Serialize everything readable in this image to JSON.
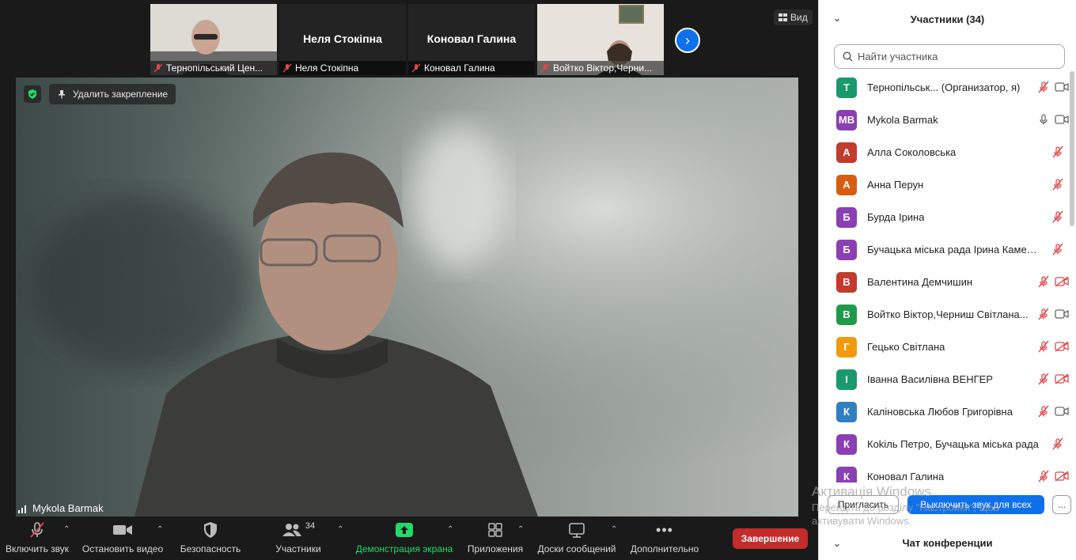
{
  "thumbnails": [
    {
      "name": "Тернопільський Цен...",
      "has_video": true,
      "muted": true
    },
    {
      "name": "Неля Стокіпна",
      "big_name": "Неля Стокіпна",
      "has_video": false,
      "muted": true
    },
    {
      "name": "Коновал Галина",
      "big_name": "Коновал Галина",
      "has_video": false,
      "muted": true
    },
    {
      "name": "Войтко Віктор,Черни...",
      "has_video": true,
      "muted": true
    }
  ],
  "view_button": "Вид",
  "unpin_label": "Удалить закрепление",
  "active_speaker": "Mykola Barmak",
  "toolbar": {
    "unmute": "Включить звук",
    "stop_video": "Остановить видео",
    "security": "Безопасность",
    "participants": "Участники",
    "participants_count": "34",
    "share": "Демонстрация экрана",
    "apps": "Приложения",
    "whiteboards": "Доски сообщений",
    "more": "Дополнительно",
    "end": "Завершение"
  },
  "panel": {
    "title": "Участники (34)",
    "search_placeholder": "Найти участника",
    "participants": [
      {
        "initials": "Т",
        "color": "#1a9a6b",
        "name": "Тернопільськ... (Организатор, я)",
        "mic": "muted",
        "video": "on"
      },
      {
        "initials": "MB",
        "color": "#8a3fb3",
        "name": "Mykola Barmak",
        "mic": "on",
        "video": "on"
      },
      {
        "initials": "А",
        "color": "#c23b2e",
        "name": "Алла Соколовська",
        "mic": "muted",
        "video": "none"
      },
      {
        "initials": "А",
        "color": "#d95d0f",
        "name": "Анна Перун",
        "mic": "muted",
        "video": "none"
      },
      {
        "initials": "Б",
        "color": "#8a3fb3",
        "name": "Бурда Ірина",
        "mic": "muted",
        "video": "none"
      },
      {
        "initials": "Б",
        "color": "#8a3fb3",
        "name": "Бучацька міська рада Ірина Камен...",
        "mic": "muted",
        "video": "none"
      },
      {
        "initials": "В",
        "color": "#c23b2e",
        "name": "Валентина Демчишин",
        "mic": "muted",
        "video": "off"
      },
      {
        "initials": "В",
        "color": "#1e9a4a",
        "name": "Войтко Віктор,Черниш Світлана...",
        "mic": "muted",
        "video": "on"
      },
      {
        "initials": "Г",
        "color": "#f29a0e",
        "name": "Гецько Світлана",
        "mic": "muted",
        "video": "off"
      },
      {
        "initials": "І",
        "color": "#1a9a6b",
        "name": "Іванна Василівна ВЕНГЕР",
        "mic": "muted",
        "video": "off"
      },
      {
        "initials": "К",
        "color": "#2f7fc1",
        "name": "Каліновська Любов Григорівна",
        "mic": "muted",
        "video": "on"
      },
      {
        "initials": "К",
        "color": "#8a3fb3",
        "name": "Коkіль Петро, Бучацька міська рада",
        "mic": "muted",
        "video": "none"
      },
      {
        "initials": "К",
        "color": "#8a3fb3",
        "name": "Коновал Галина",
        "mic": "muted",
        "video": "off"
      }
    ],
    "invite": "Пригласить",
    "mute_all": "Выключить звук для всех",
    "more": "...",
    "chat_title": "Чат конференции"
  },
  "watermark": {
    "line1": "Активація Windows",
    "line2": "Перейдіть до розділу \"Настройки\", щоб",
    "line3": "активувати Windows."
  }
}
